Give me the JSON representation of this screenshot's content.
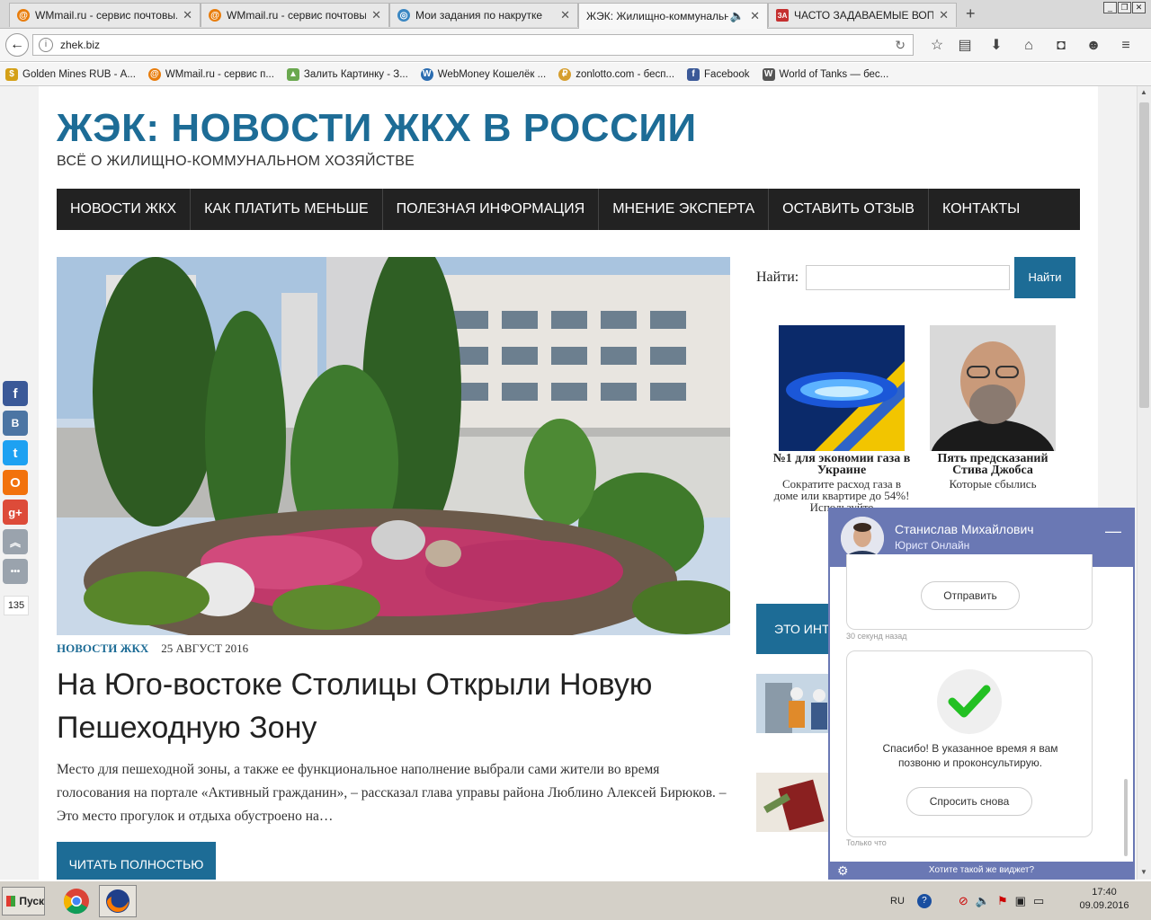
{
  "browser": {
    "tabs": [
      {
        "title": "WMmail.ru - сервис почтовы...",
        "color": "#e87d0d",
        "glyph": "@"
      },
      {
        "title": "WMmail.ru - сервис почтовы...",
        "color": "#e87d0d",
        "glyph": "@"
      },
      {
        "title": "Мои задания по накрутке",
        "color": "#3b87c2",
        "glyph": "◎"
      },
      {
        "title": "ЖЭК: Жилищно-коммунальн...",
        "color": "",
        "glyph": ""
      },
      {
        "title": "ЧАСТО ЗАДАВАЕМЫЕ ВОПР...",
        "color": "#c53030",
        "glyph": "ЗА"
      }
    ],
    "new_tab": "+",
    "url": "zhek.biz",
    "bookmarks": [
      {
        "label": "Golden Mines RUB - А...",
        "color": "#d4a017",
        "glyph": "$"
      },
      {
        "label": "WMmail.ru - сервис п...",
        "color": "#e87d0d",
        "glyph": "@"
      },
      {
        "label": "Залить Картинку - З...",
        "color": "#6aa84f",
        "glyph": "▲"
      },
      {
        "label": "WebMoney Кошелёк ...",
        "color": "#2b6cb0",
        "glyph": "W"
      },
      {
        "label": "zonlotto.com - бесп...",
        "color": "#d69e2e",
        "glyph": "₽"
      },
      {
        "label": "Facebook",
        "color": "#3b5998",
        "glyph": "f"
      },
      {
        "label": "World of Tanks — бес...",
        "color": "#555555",
        "glyph": "W"
      }
    ]
  },
  "site": {
    "title": "ЖЭК: НОВОСТИ ЖКХ В РОССИИ",
    "description": "ВСЁ О ЖИЛИЩНО-КОММУНАЛЬНОМ ХОЗЯЙСТВЕ",
    "menu": [
      "НОВОСТИ ЖКХ",
      "КАК ПЛАТИТЬ МЕНЬШЕ",
      "ПОЛЕЗНАЯ ИНФОРМАЦИЯ",
      "МНЕНИЕ ЭКСПЕРТА",
      "ОСТАВИТЬ ОТЗЫВ",
      "КОНТАКТЫ"
    ],
    "accent": "#1d6c96"
  },
  "post": {
    "category": "НОВОСТИ ЖКХ",
    "date": "25 АВГУСТ 2016",
    "title": "На Юго-востоке Столицы Открыли Новую Пешеходную Зону",
    "excerpt": "Место для пешеходной зоны, а также ее функциональное наполнение выбрали сами жители во время голосования на портале «Активный гражданин», – рассказал глава управы района Люблино Алексей Бирюков. – Это место прогулок и отдыха обустроено на…",
    "read_more": "ЧИТАТЬ ПОЛНОСТЬЮ"
  },
  "sidebar": {
    "search_label": "Найти:",
    "search_value": "",
    "search_button": "Найти",
    "cards": [
      {
        "title": "№1 для экономии газа в Украине",
        "desc": "Сократите расход газа в доме или квартире до 54%! Используйте"
      },
      {
        "title": "Пять предсказаний Стива Джобса",
        "desc": "Которые сбылись"
      }
    ],
    "interest_box": "ЭТО ИНТЕРЕСНО"
  },
  "social": {
    "buttons": [
      {
        "name": "facebook",
        "glyph": "f",
        "color": "#3b5998"
      },
      {
        "name": "vkontakte",
        "glyph": "В",
        "color": "#4c75a3"
      },
      {
        "name": "twitter",
        "glyph": "t",
        "color": "#1da1f2"
      },
      {
        "name": "odnoklassniki",
        "glyph": "О",
        "color": "#f2720c"
      },
      {
        "name": "googleplus",
        "glyph": "g+",
        "color": "#dd4b39"
      },
      {
        "name": "scroll-up",
        "glyph": "︽",
        "color": "#9aa3ad"
      },
      {
        "name": "more",
        "glyph": "•••",
        "color": "#9aa3ad"
      }
    ],
    "share_count": "135"
  },
  "chat": {
    "agent_name": "Станислав Михайлович",
    "agent_role": "Юрист Онлайн",
    "minimize": "—",
    "send_button": "Отправить",
    "time_ago": "30 секунд назад",
    "thanks_text": "Спасибо! В указанное время я вам позвоню и проконсультирую.",
    "ask_again": "Спросить снова",
    "just_now": "Только что",
    "footer": "Хотите такой же виджет?",
    "accent": "#6a78b4"
  },
  "taskbar": {
    "start": "Пуск",
    "lang": "RU",
    "time": "17:40",
    "date": "09.09.2016"
  }
}
